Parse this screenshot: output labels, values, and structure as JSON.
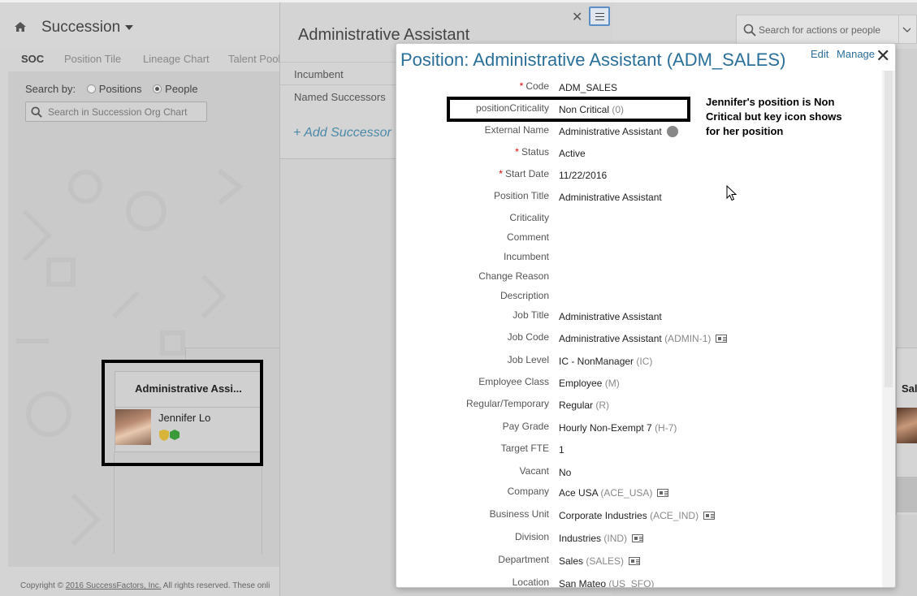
{
  "app": {
    "title": "Succession"
  },
  "global_search": {
    "placeholder": "Search for actions or people"
  },
  "subnav": {
    "items": [
      "SOC",
      "Position Tile",
      "Lineage Chart",
      "Talent Pool"
    ]
  },
  "org_panel": {
    "search_by_label": "Search by:",
    "radio_positions": "Positions",
    "radio_people": "People",
    "selected": "People",
    "search_placeholder": "Search in Succession Org Chart",
    "card": {
      "title": "Administrative Assi...",
      "incumbent": "Jennifer Lo"
    },
    "right_card_label": "Sal"
  },
  "footer": {
    "text": "Copyright © ",
    "link": "2016 SuccessFactors, Inc.",
    "rest": " All rights reserved. These onli"
  },
  "mid_panel": {
    "title": "Administrative Assistant",
    "rows": [
      "Incumbent",
      "Named Successors"
    ],
    "add_successor": "Add Successor"
  },
  "dialog": {
    "title": "Position: Administrative Assistant (ADM_SALES)",
    "edit": "Edit",
    "manage": "Manage",
    "fields": [
      {
        "label": "Code",
        "required": true,
        "value": "ADM_SALES",
        "code": ""
      },
      {
        "label": "positionCriticality",
        "required": false,
        "value": "Non Critical",
        "code": "(0)"
      },
      {
        "label": "External Name",
        "required": false,
        "value": "Administrative Assistant",
        "code": ""
      },
      {
        "label": "Status",
        "required": true,
        "value": "Active",
        "code": ""
      },
      {
        "label": "Start Date",
        "required": true,
        "value": "11/22/2016",
        "code": ""
      },
      {
        "label": "Position Title",
        "required": false,
        "value": "Administrative Assistant",
        "code": ""
      },
      {
        "label": "Criticality",
        "required": false,
        "value": "",
        "code": ""
      },
      {
        "label": "Comment",
        "required": false,
        "value": "",
        "code": ""
      },
      {
        "label": "Incumbent",
        "required": false,
        "value": "",
        "code": ""
      },
      {
        "label": "Change Reason",
        "required": false,
        "value": "",
        "code": ""
      },
      {
        "label": "Description",
        "required": false,
        "value": "",
        "code": ""
      },
      {
        "label": "Job Title",
        "required": false,
        "value": "Administrative Assistant",
        "code": ""
      },
      {
        "label": "Job Code",
        "required": false,
        "value": "Administrative Assistant",
        "code": "(ADMIN-1)"
      },
      {
        "label": "Job Level",
        "required": false,
        "value": "IC - NonManager",
        "code": "(IC)"
      },
      {
        "label": "Employee Class",
        "required": false,
        "value": "Employee",
        "code": "(M)"
      },
      {
        "label": "Regular/Temporary",
        "required": false,
        "value": "Regular",
        "code": "(R)"
      },
      {
        "label": "Pay Grade",
        "required": false,
        "value": "Hourly Non-Exempt 7",
        "code": "(H-7)"
      },
      {
        "label": "Target FTE",
        "required": false,
        "value": "1",
        "code": ""
      },
      {
        "label": "Vacant",
        "required": false,
        "value": "No",
        "code": ""
      },
      {
        "label": "Company",
        "required": false,
        "value": "Ace USA",
        "code": "(ACE_USA)"
      },
      {
        "label": "Business Unit",
        "required": false,
        "value": "Corporate Industries",
        "code": "(ACE_IND)"
      },
      {
        "label": "Division",
        "required": false,
        "value": "Industries",
        "code": "(IND)"
      },
      {
        "label": "Department",
        "required": false,
        "value": "Sales",
        "code": "(SALES)"
      },
      {
        "label": "Location",
        "required": false,
        "value": "San Mateo",
        "code": "(US_SFO)"
      }
    ]
  },
  "annotation": {
    "text": "Jennifer's position is Non Critical but key icon shows for her position"
  },
  "colors": {
    "accent": "#2a6f99",
    "required": "#dd0000",
    "link": "#4a8aa8"
  }
}
